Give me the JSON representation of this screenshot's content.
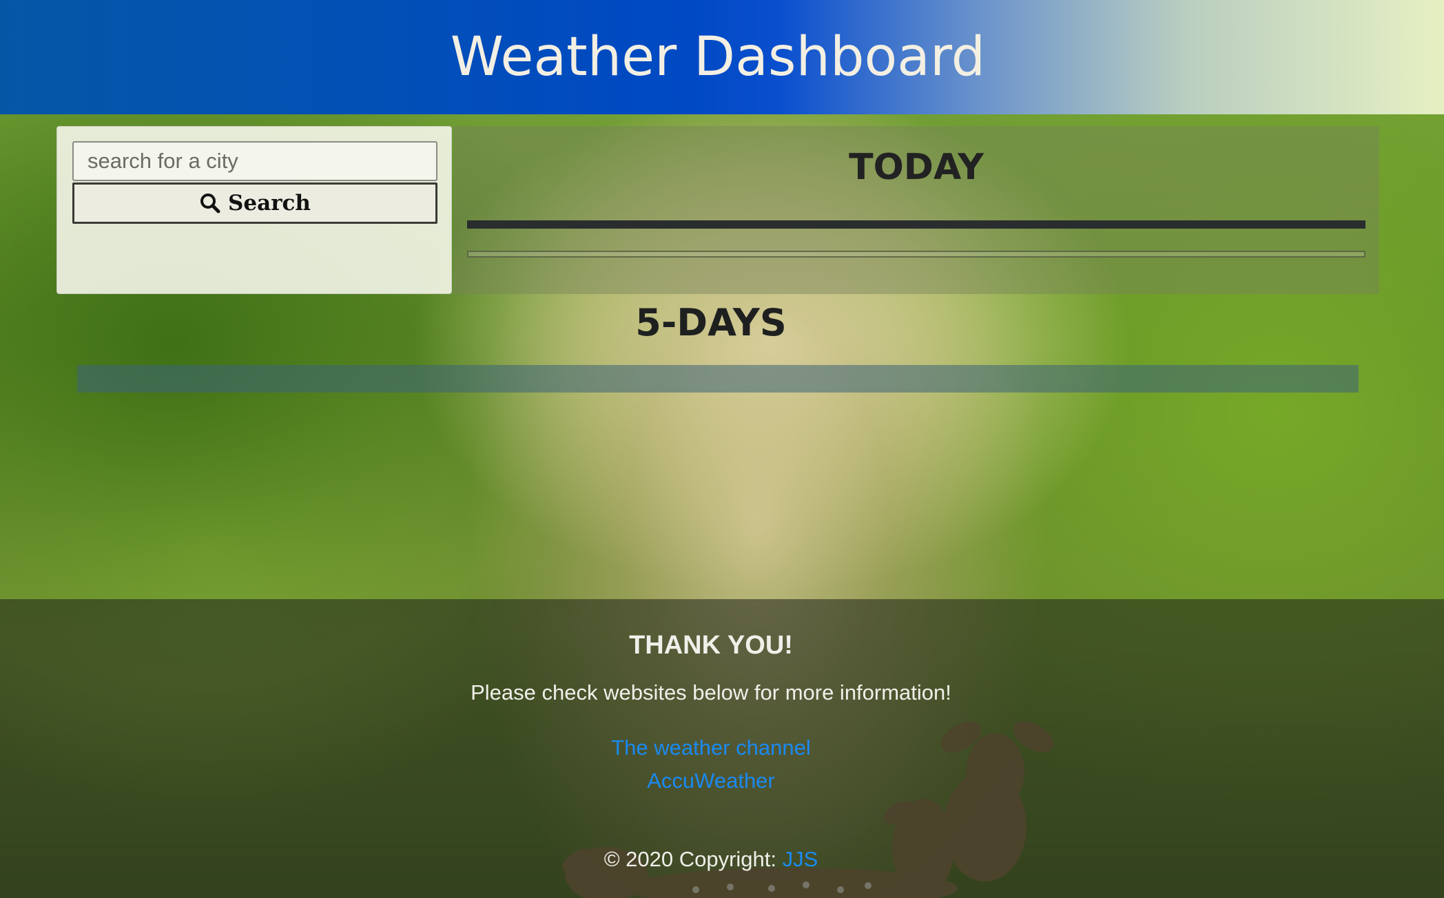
{
  "header": {
    "title": "Weather Dashboard"
  },
  "search": {
    "placeholder": "search for a city",
    "button_label": "Search",
    "button_icon": "search-icon"
  },
  "today": {
    "title": "TODAY"
  },
  "forecast": {
    "title": "5-DAYS"
  },
  "footer": {
    "heading": "THANK YOU!",
    "subtitle": "Please check websites below for more information!",
    "links": [
      {
        "label": "The weather channel"
      },
      {
        "label": "AccuWeather"
      }
    ],
    "copyright_prefix": "© 2020 Copyright: ",
    "copyright_link": "JJS"
  },
  "colors": {
    "header_left": "#0557a6",
    "header_mid": "#0049c4",
    "header_right": "#e6f0c2",
    "link": "#1a8af0"
  }
}
